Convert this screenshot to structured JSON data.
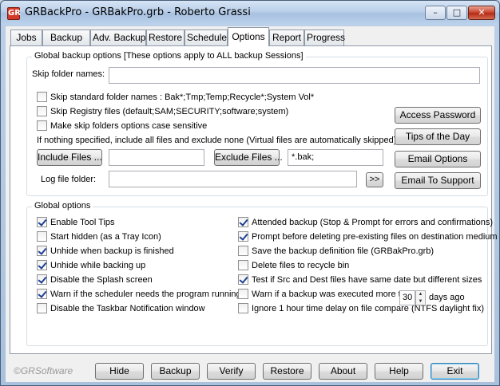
{
  "window": {
    "title": "GRBackPro - GRBakPro.grb - Roberto Grassi",
    "app_icon": "GR",
    "controls": {
      "minimize": "–",
      "maximize": "□",
      "close": "✕"
    }
  },
  "tabs": [
    {
      "label": "Jobs"
    },
    {
      "label": "Backup"
    },
    {
      "label": "Adv. Backup"
    },
    {
      "label": "Restore"
    },
    {
      "label": "Schedule"
    },
    {
      "label": "Options",
      "active": true
    },
    {
      "label": "Report"
    },
    {
      "label": "Progress"
    }
  ],
  "global_backup": {
    "title": "Global backup options [These options apply to ALL backup Sessions]",
    "skip_folder_label": "Skip folder names:",
    "skip_folder_value": "",
    "skip_standard": {
      "label": "Skip standard folder names : Bak*;Tmp;Temp;Recycle*;System Vol*",
      "checked": false
    },
    "skip_registry": {
      "label": "Skip Registry files (default;SAM;SECURITY;software;system)",
      "checked": false
    },
    "case_sensitive": {
      "label": "Make skip folders options case sensitive",
      "checked": false
    },
    "note": "If nothing specified, include all files and exclude none (Virtual files are automatically skipped)",
    "include_button": "Include Files ...",
    "include_value": "",
    "exclude_button": "Exclude Files ...",
    "exclude_value": "*.bak;",
    "log_label": "Log file folder:",
    "log_value": "",
    "browse_button": ">>",
    "access_password": "Access Password",
    "tips_of_day": "Tips of the Day",
    "email_options": "Email Options",
    "email_support": "Email To Support"
  },
  "global_options": {
    "title": "Global options",
    "left": [
      {
        "label": "Enable Tool Tips",
        "checked": true
      },
      {
        "label": "Start hidden (as a Tray Icon)",
        "checked": false
      },
      {
        "label": "Unhide when backup is finished",
        "checked": true
      },
      {
        "label": "Unhide while backing up",
        "checked": true
      },
      {
        "label": "Disable the Splash screen",
        "checked": true
      },
      {
        "label": "Warn if the scheduler needs the program running",
        "checked": true
      },
      {
        "label": "Disable the Taskbar Notification window",
        "checked": false
      }
    ],
    "right": [
      {
        "label": "Attended backup (Stop & Prompt for errors and confirmations)",
        "checked": true
      },
      {
        "label": "Prompt before deleting pre-existing files on destination medium",
        "checked": true
      },
      {
        "label": "Save the backup definition file (GRBakPro.grb)",
        "checked": false
      },
      {
        "label": "Delete files to recycle bin",
        "checked": false
      },
      {
        "label": "Test if Src and Dest files have same date but different sizes",
        "checked": true
      },
      {
        "label": "Warn if a backup was executed more than",
        "checked": false,
        "days_value": "30",
        "days_suffix": "days ago"
      },
      {
        "label": "Ignore 1 hour time delay on file compare (NTFS daylight fix)",
        "checked": false
      }
    ]
  },
  "footer": {
    "brand": "©GRSoftware",
    "buttons": [
      "Hide",
      "Backup",
      "Verify",
      "Restore",
      "About",
      "Help",
      "Exit"
    ]
  }
}
